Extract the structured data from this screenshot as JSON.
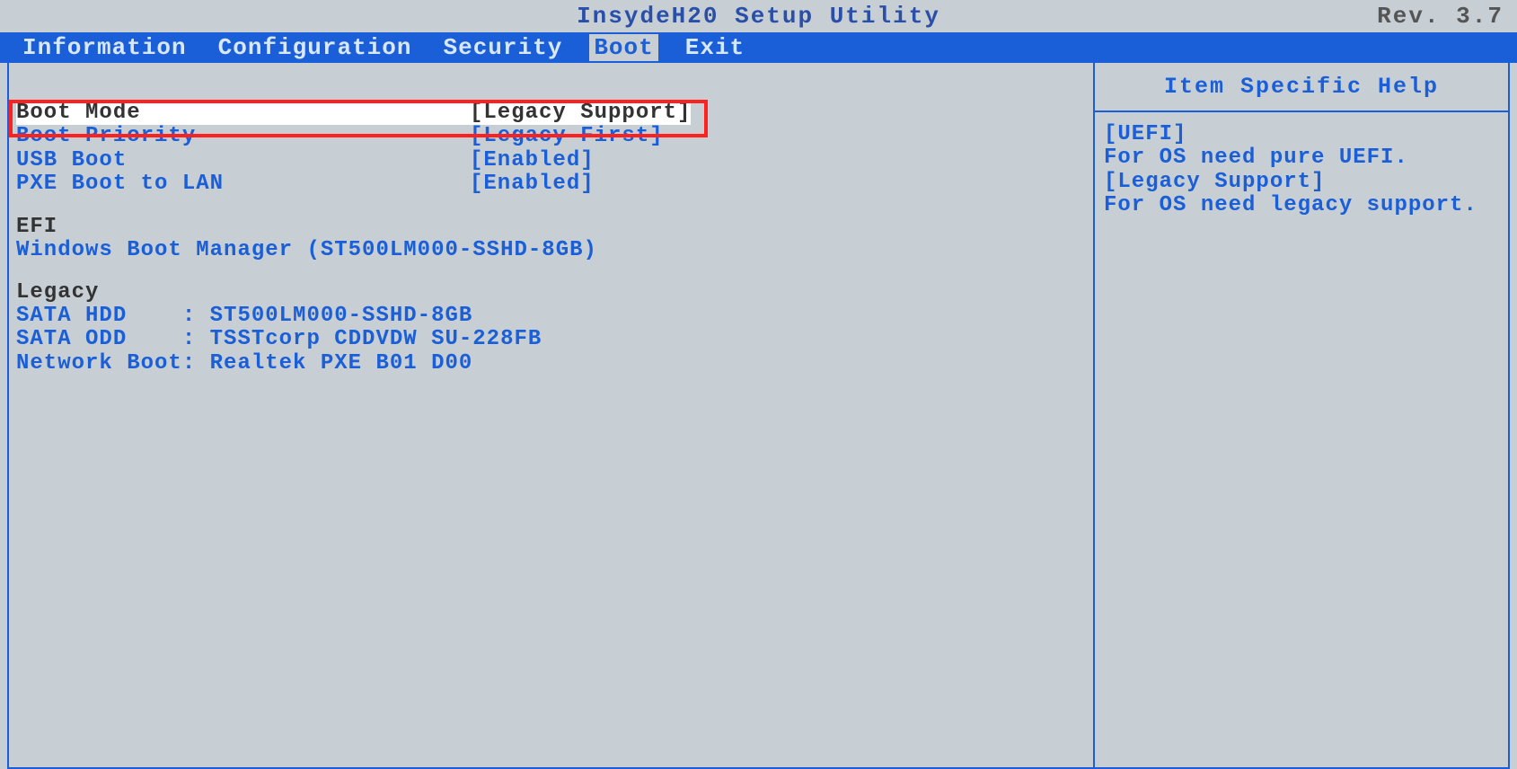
{
  "header": {
    "title": "InsydeH20 Setup Utility",
    "revision": "Rev. 3.7"
  },
  "menu": {
    "items": [
      "Information",
      "Configuration",
      "Security",
      "Boot",
      "Exit"
    ],
    "active_index": 3
  },
  "settings": [
    {
      "label": "Boot Mode",
      "value": "[Legacy Support]",
      "selected": true
    },
    {
      "label": "Boot Priority",
      "value": "[Legacy First]",
      "selected": false
    },
    {
      "label": "USB Boot",
      "value": "[Enabled]",
      "selected": false
    },
    {
      "label": "PXE Boot to LAN",
      "value": "[Enabled]",
      "selected": false
    }
  ],
  "efi_section": {
    "header": "EFI",
    "entries": [
      "Windows Boot Manager (ST500LM000-SSHD-8GB)"
    ]
  },
  "legacy_section": {
    "header": "Legacy",
    "entries": [
      "SATA HDD    : ST500LM000-SSHD-8GB",
      "SATA ODD    : TSSTcorp CDDVDW SU-228FB",
      "Network Boot: Realtek PXE B01 D00"
    ]
  },
  "help": {
    "title": "Item Specific Help",
    "lines": [
      "[UEFI]",
      "For OS need pure UEFI.",
      "[Legacy Support]",
      "For OS need legacy support."
    ]
  }
}
